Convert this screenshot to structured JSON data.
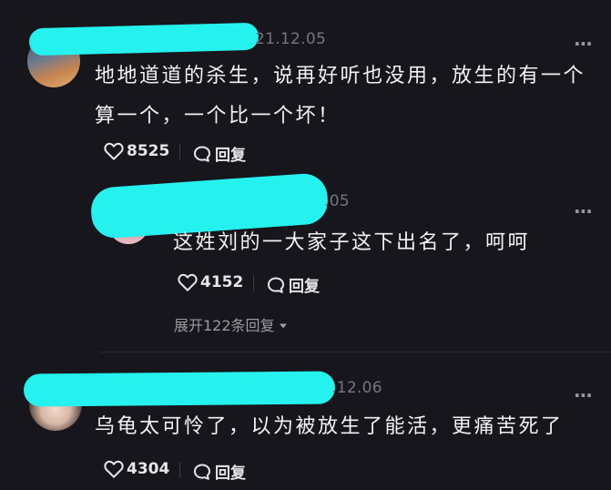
{
  "comments": [
    {
      "date": "21.12.05",
      "content": "地地道道的杀生，说再好听也没用，放生的有一个算一个，一个比一个坏！",
      "likes": "8525",
      "reply_label": "回复"
    },
    {
      "date": ".05",
      "content": "这姓刘的一大家子这下出名了，呵呵",
      "likes": "4152",
      "reply_label": "回复",
      "expand_label": "展开122条回复"
    },
    {
      "date": ".12.06",
      "content": "乌龟太可怜了，以为被放生了能活，更痛苦死了",
      "likes": "4304",
      "reply_label": "回复"
    }
  ],
  "more_label": "...",
  "colors": {
    "background": "#17161c",
    "redaction": "#25f2ee",
    "muted": "#76757c"
  }
}
